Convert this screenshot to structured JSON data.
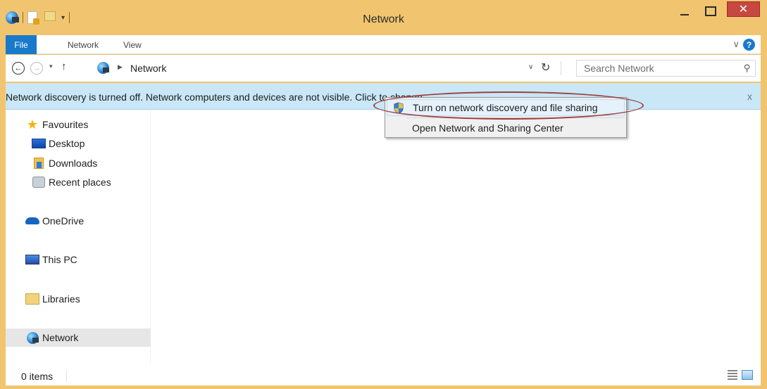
{
  "window": {
    "title": "Network",
    "close_glyph": "✕"
  },
  "ribbon": {
    "tabs": [
      "File",
      "Network",
      "View"
    ],
    "help_glyph": "?",
    "expand_glyph": "∨"
  },
  "address_bar": {
    "location": "Network",
    "search_placeholder": "Search Network"
  },
  "info_bar": {
    "message": "Network discovery is turned off. Network computers and devices are not visible. Click to change.",
    "close_glyph": "x"
  },
  "nav_pane": {
    "favourites": "Favourites",
    "desktop": "Desktop",
    "downloads": "Downloads",
    "recent_places": "Recent places",
    "onedrive": "OneDrive",
    "this_pc": "This PC",
    "libraries": "Libraries",
    "network": "Network"
  },
  "context_menu": {
    "items": [
      "Turn on network discovery and file sharing",
      "Open Network and Sharing Center"
    ]
  },
  "status_bar": {
    "item_count": "0 items"
  },
  "colors": {
    "title_bar": "#f1c56f",
    "file_tab": "#1979ca",
    "info_bar": "#c9e7f7",
    "close_button": "#c74840",
    "annotation_oval": "#9e3e3e"
  },
  "icons": [
    "globe-icon",
    "properties-icon",
    "new-folder-icon",
    "back-arrow-icon",
    "forward-arrow-icon",
    "up-arrow-icon",
    "refresh-icon",
    "search-icon",
    "star-icon",
    "desktop-icon",
    "downloads-icon",
    "recent-places-icon",
    "onedrive-icon",
    "this-pc-icon",
    "libraries-icon",
    "network-icon",
    "shield-icon",
    "details-view-icon",
    "tiles-view-icon"
  ]
}
